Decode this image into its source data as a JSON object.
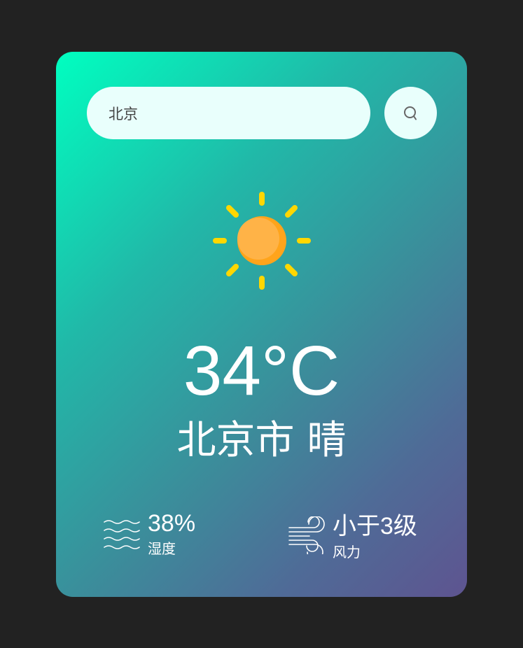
{
  "search": {
    "value": "北京",
    "button_icon": "search-icon"
  },
  "weather": {
    "icon": "sun-icon",
    "temperature": "34°C",
    "city": "北京市",
    "condition": "晴"
  },
  "humidity": {
    "icon": "humidity-waves-icon",
    "value": "38%",
    "label": "湿度"
  },
  "wind": {
    "icon": "wind-icon",
    "value": "小于3级",
    "label": "风力"
  },
  "colors": {
    "page_background": "#222222",
    "card_gradient_start": "#00ffc0",
    "card_gradient_end": "#5e5490",
    "search_background": "#e9fffc",
    "sun_body": "#ffb347",
    "sun_rays": "#ffd700"
  }
}
